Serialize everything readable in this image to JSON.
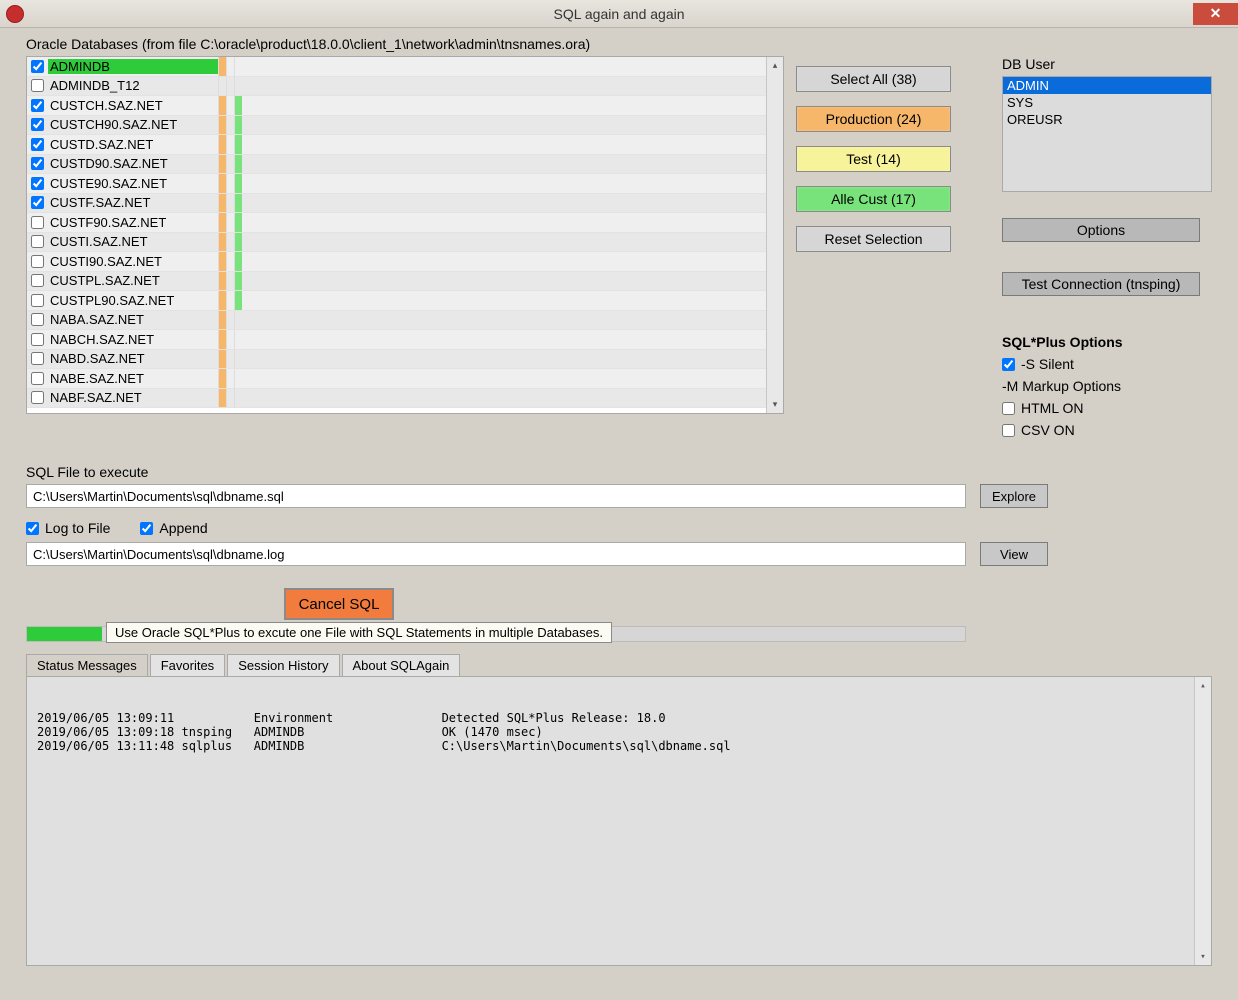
{
  "window": {
    "title": "SQL again and again"
  },
  "db_section": {
    "label": "Oracle Databases (from file C:\\oracle\\product\\18.0.0\\client_1\\network\\admin\\tnsnames.ora)",
    "rows": [
      {
        "checked": true,
        "name": "ADMINDB",
        "selected": true,
        "prod": true,
        "test": false,
        "cust": false
      },
      {
        "checked": false,
        "name": "ADMINDB_T12",
        "selected": false,
        "prod": false,
        "test": false,
        "cust": false
      },
      {
        "checked": true,
        "name": "CUSTCH.SAZ.NET",
        "selected": false,
        "prod": true,
        "test": false,
        "cust": true
      },
      {
        "checked": true,
        "name": "CUSTCH90.SAZ.NET",
        "selected": false,
        "prod": true,
        "test": false,
        "cust": true
      },
      {
        "checked": true,
        "name": "CUSTD.SAZ.NET",
        "selected": false,
        "prod": true,
        "test": false,
        "cust": true
      },
      {
        "checked": true,
        "name": "CUSTD90.SAZ.NET",
        "selected": false,
        "prod": true,
        "test": false,
        "cust": true
      },
      {
        "checked": true,
        "name": "CUSTE90.SAZ.NET",
        "selected": false,
        "prod": true,
        "test": false,
        "cust": true
      },
      {
        "checked": true,
        "name": "CUSTF.SAZ.NET",
        "selected": false,
        "prod": true,
        "test": false,
        "cust": true
      },
      {
        "checked": false,
        "name": "CUSTF90.SAZ.NET",
        "selected": false,
        "prod": true,
        "test": false,
        "cust": true
      },
      {
        "checked": false,
        "name": "CUSTI.SAZ.NET",
        "selected": false,
        "prod": true,
        "test": false,
        "cust": true
      },
      {
        "checked": false,
        "name": "CUSTI90.SAZ.NET",
        "selected": false,
        "prod": true,
        "test": false,
        "cust": true
      },
      {
        "checked": false,
        "name": "CUSTPL.SAZ.NET",
        "selected": false,
        "prod": true,
        "test": false,
        "cust": true
      },
      {
        "checked": false,
        "name": "CUSTPL90.SAZ.NET",
        "selected": false,
        "prod": true,
        "test": false,
        "cust": true
      },
      {
        "checked": false,
        "name": "NABA.SAZ.NET",
        "selected": false,
        "prod": true,
        "test": false,
        "cust": false
      },
      {
        "checked": false,
        "name": "NABCH.SAZ.NET",
        "selected": false,
        "prod": true,
        "test": false,
        "cust": false
      },
      {
        "checked": false,
        "name": "NABD.SAZ.NET",
        "selected": false,
        "prod": true,
        "test": false,
        "cust": false
      },
      {
        "checked": false,
        "name": "NABE.SAZ.NET",
        "selected": false,
        "prod": true,
        "test": false,
        "cust": false
      },
      {
        "checked": false,
        "name": "NABF.SAZ.NET",
        "selected": false,
        "prod": true,
        "test": false,
        "cust": false
      }
    ]
  },
  "filters": {
    "select_all": "Select All (38)",
    "production": "Production (24)",
    "test": "Test (14)",
    "alle_cust": "Alle Cust (17)",
    "reset": "Reset Selection"
  },
  "db_user": {
    "label": "DB User",
    "items": [
      "ADMIN",
      "SYS",
      "OREUSR"
    ],
    "selected_index": 0
  },
  "options_btn": "Options",
  "test_conn_btn": "Test Connection (tnsping)",
  "sqlplus": {
    "heading": "SQL*Plus Options",
    "silent": "-S Silent",
    "silent_checked": true,
    "markup": "-M Markup Options",
    "html_on": "HTML ON",
    "html_on_checked": false,
    "csv_on": "CSV ON",
    "csv_on_checked": false
  },
  "sql_file": {
    "label": "SQL File to execute",
    "value": "C:\\Users\\Martin\\Documents\\sql\\dbname.sql",
    "explore": "Explore"
  },
  "log": {
    "log_to_file": "Log to File",
    "log_to_file_checked": true,
    "append": "Append",
    "append_checked": true,
    "value": "C:\\Users\\Martin\\Documents\\sql\\dbname.log",
    "view": "View"
  },
  "cancel_btn": "Cancel SQL",
  "tooltip": "Use Oracle SQL*Plus to excute one File with SQL Statements in multiple Databases.",
  "tabs": {
    "items": [
      "Status Messages",
      "Favorites",
      "Session History",
      "About SQLAgain"
    ],
    "active_index": 0
  },
  "status_lines": [
    {
      "ts": "2019/06/05 13:09:11",
      "tool": "",
      "db": "Environment",
      "msg": "Detected SQL*Plus Release: 18.0"
    },
    {
      "ts": "2019/06/05 13:09:18",
      "tool": "tnsping",
      "db": "ADMINDB",
      "msg": "OK (1470 msec)"
    },
    {
      "ts": "2019/06/05 13:11:48",
      "tool": "sqlplus",
      "db": "ADMINDB",
      "msg": "C:\\Users\\Martin\\Documents\\sql\\dbname.sql"
    }
  ]
}
